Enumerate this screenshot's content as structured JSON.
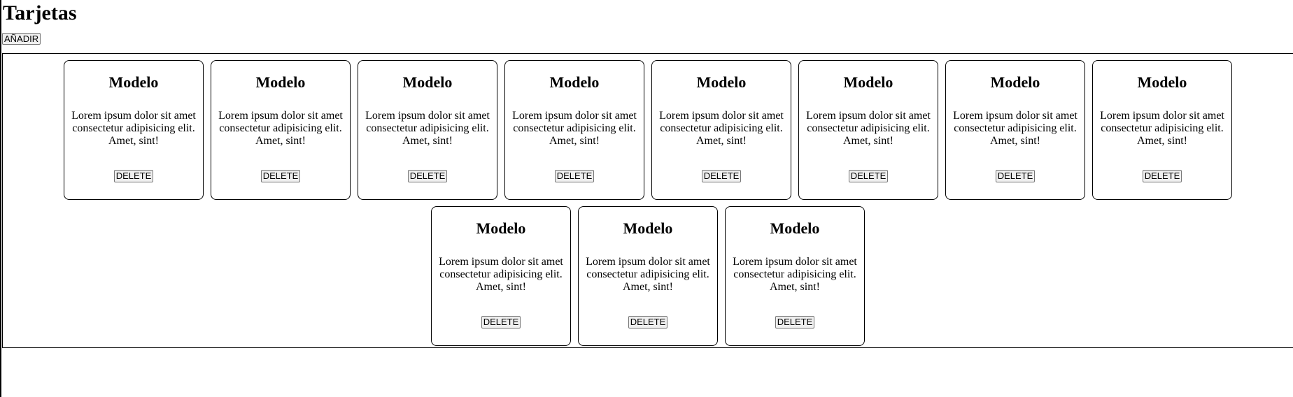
{
  "header": {
    "title": "Tarjetas",
    "add_label": "AÑADIR"
  },
  "cards": [
    {
      "title": "Modelo",
      "text": "Lorem ipsum dolor sit amet consectetur adipisicing elit. Amet, sint!",
      "delete_label": "DELETE"
    },
    {
      "title": "Modelo",
      "text": "Lorem ipsum dolor sit amet consectetur adipisicing elit. Amet, sint!",
      "delete_label": "DELETE"
    },
    {
      "title": "Modelo",
      "text": "Lorem ipsum dolor sit amet consectetur adipisicing elit. Amet, sint!",
      "delete_label": "DELETE"
    },
    {
      "title": "Modelo",
      "text": "Lorem ipsum dolor sit amet consectetur adipisicing elit. Amet, sint!",
      "delete_label": "DELETE"
    },
    {
      "title": "Modelo",
      "text": "Lorem ipsum dolor sit amet consectetur adipisicing elit. Amet, sint!",
      "delete_label": "DELETE"
    },
    {
      "title": "Modelo",
      "text": "Lorem ipsum dolor sit amet consectetur adipisicing elit. Amet, sint!",
      "delete_label": "DELETE"
    },
    {
      "title": "Modelo",
      "text": "Lorem ipsum dolor sit amet consectetur adipisicing elit. Amet, sint!",
      "delete_label": "DELETE"
    },
    {
      "title": "Modelo",
      "text": "Lorem ipsum dolor sit amet consectetur adipisicing elit. Amet, sint!",
      "delete_label": "DELETE"
    },
    {
      "title": "Modelo",
      "text": "Lorem ipsum dolor sit amet consectetur adipisicing elit. Amet, sint!",
      "delete_label": "DELETE"
    },
    {
      "title": "Modelo",
      "text": "Lorem ipsum dolor sit amet consectetur adipisicing elit. Amet, sint!",
      "delete_label": "DELETE"
    },
    {
      "title": "Modelo",
      "text": "Lorem ipsum dolor sit amet consectetur adipisicing elit. Amet, sint!",
      "delete_label": "DELETE"
    }
  ]
}
